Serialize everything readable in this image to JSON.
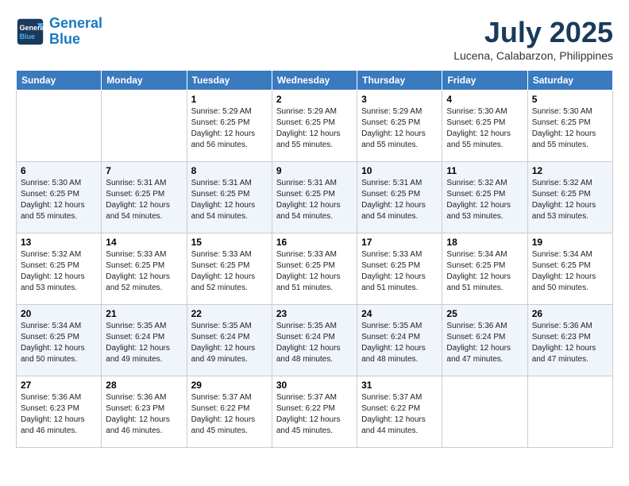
{
  "header": {
    "logo_line1": "General",
    "logo_line2": "Blue",
    "month": "July 2025",
    "location": "Lucena, Calabarzon, Philippines"
  },
  "days_of_week": [
    "Sunday",
    "Monday",
    "Tuesday",
    "Wednesday",
    "Thursday",
    "Friday",
    "Saturday"
  ],
  "weeks": [
    [
      {
        "day": "",
        "sunrise": "",
        "sunset": "",
        "daylight": ""
      },
      {
        "day": "",
        "sunrise": "",
        "sunset": "",
        "daylight": ""
      },
      {
        "day": "1",
        "sunrise": "Sunrise: 5:29 AM",
        "sunset": "Sunset: 6:25 PM",
        "daylight": "Daylight: 12 hours and 56 minutes."
      },
      {
        "day": "2",
        "sunrise": "Sunrise: 5:29 AM",
        "sunset": "Sunset: 6:25 PM",
        "daylight": "Daylight: 12 hours and 55 minutes."
      },
      {
        "day": "3",
        "sunrise": "Sunrise: 5:29 AM",
        "sunset": "Sunset: 6:25 PM",
        "daylight": "Daylight: 12 hours and 55 minutes."
      },
      {
        "day": "4",
        "sunrise": "Sunrise: 5:30 AM",
        "sunset": "Sunset: 6:25 PM",
        "daylight": "Daylight: 12 hours and 55 minutes."
      },
      {
        "day": "5",
        "sunrise": "Sunrise: 5:30 AM",
        "sunset": "Sunset: 6:25 PM",
        "daylight": "Daylight: 12 hours and 55 minutes."
      }
    ],
    [
      {
        "day": "6",
        "sunrise": "Sunrise: 5:30 AM",
        "sunset": "Sunset: 6:25 PM",
        "daylight": "Daylight: 12 hours and 55 minutes."
      },
      {
        "day": "7",
        "sunrise": "Sunrise: 5:31 AM",
        "sunset": "Sunset: 6:25 PM",
        "daylight": "Daylight: 12 hours and 54 minutes."
      },
      {
        "day": "8",
        "sunrise": "Sunrise: 5:31 AM",
        "sunset": "Sunset: 6:25 PM",
        "daylight": "Daylight: 12 hours and 54 minutes."
      },
      {
        "day": "9",
        "sunrise": "Sunrise: 5:31 AM",
        "sunset": "Sunset: 6:25 PM",
        "daylight": "Daylight: 12 hours and 54 minutes."
      },
      {
        "day": "10",
        "sunrise": "Sunrise: 5:31 AM",
        "sunset": "Sunset: 6:25 PM",
        "daylight": "Daylight: 12 hours and 54 minutes."
      },
      {
        "day": "11",
        "sunrise": "Sunrise: 5:32 AM",
        "sunset": "Sunset: 6:25 PM",
        "daylight": "Daylight: 12 hours and 53 minutes."
      },
      {
        "day": "12",
        "sunrise": "Sunrise: 5:32 AM",
        "sunset": "Sunset: 6:25 PM",
        "daylight": "Daylight: 12 hours and 53 minutes."
      }
    ],
    [
      {
        "day": "13",
        "sunrise": "Sunrise: 5:32 AM",
        "sunset": "Sunset: 6:25 PM",
        "daylight": "Daylight: 12 hours and 53 minutes."
      },
      {
        "day": "14",
        "sunrise": "Sunrise: 5:33 AM",
        "sunset": "Sunset: 6:25 PM",
        "daylight": "Daylight: 12 hours and 52 minutes."
      },
      {
        "day": "15",
        "sunrise": "Sunrise: 5:33 AM",
        "sunset": "Sunset: 6:25 PM",
        "daylight": "Daylight: 12 hours and 52 minutes."
      },
      {
        "day": "16",
        "sunrise": "Sunrise: 5:33 AM",
        "sunset": "Sunset: 6:25 PM",
        "daylight": "Daylight: 12 hours and 51 minutes."
      },
      {
        "day": "17",
        "sunrise": "Sunrise: 5:33 AM",
        "sunset": "Sunset: 6:25 PM",
        "daylight": "Daylight: 12 hours and 51 minutes."
      },
      {
        "day": "18",
        "sunrise": "Sunrise: 5:34 AM",
        "sunset": "Sunset: 6:25 PM",
        "daylight": "Daylight: 12 hours and 51 minutes."
      },
      {
        "day": "19",
        "sunrise": "Sunrise: 5:34 AM",
        "sunset": "Sunset: 6:25 PM",
        "daylight": "Daylight: 12 hours and 50 minutes."
      }
    ],
    [
      {
        "day": "20",
        "sunrise": "Sunrise: 5:34 AM",
        "sunset": "Sunset: 6:25 PM",
        "daylight": "Daylight: 12 hours and 50 minutes."
      },
      {
        "day": "21",
        "sunrise": "Sunrise: 5:35 AM",
        "sunset": "Sunset: 6:24 PM",
        "daylight": "Daylight: 12 hours and 49 minutes."
      },
      {
        "day": "22",
        "sunrise": "Sunrise: 5:35 AM",
        "sunset": "Sunset: 6:24 PM",
        "daylight": "Daylight: 12 hours and 49 minutes."
      },
      {
        "day": "23",
        "sunrise": "Sunrise: 5:35 AM",
        "sunset": "Sunset: 6:24 PM",
        "daylight": "Daylight: 12 hours and 48 minutes."
      },
      {
        "day": "24",
        "sunrise": "Sunrise: 5:35 AM",
        "sunset": "Sunset: 6:24 PM",
        "daylight": "Daylight: 12 hours and 48 minutes."
      },
      {
        "day": "25",
        "sunrise": "Sunrise: 5:36 AM",
        "sunset": "Sunset: 6:24 PM",
        "daylight": "Daylight: 12 hours and 47 minutes."
      },
      {
        "day": "26",
        "sunrise": "Sunrise: 5:36 AM",
        "sunset": "Sunset: 6:23 PM",
        "daylight": "Daylight: 12 hours and 47 minutes."
      }
    ],
    [
      {
        "day": "27",
        "sunrise": "Sunrise: 5:36 AM",
        "sunset": "Sunset: 6:23 PM",
        "daylight": "Daylight: 12 hours and 46 minutes."
      },
      {
        "day": "28",
        "sunrise": "Sunrise: 5:36 AM",
        "sunset": "Sunset: 6:23 PM",
        "daylight": "Daylight: 12 hours and 46 minutes."
      },
      {
        "day": "29",
        "sunrise": "Sunrise: 5:37 AM",
        "sunset": "Sunset: 6:22 PM",
        "daylight": "Daylight: 12 hours and 45 minutes."
      },
      {
        "day": "30",
        "sunrise": "Sunrise: 5:37 AM",
        "sunset": "Sunset: 6:22 PM",
        "daylight": "Daylight: 12 hours and 45 minutes."
      },
      {
        "day": "31",
        "sunrise": "Sunrise: 5:37 AM",
        "sunset": "Sunset: 6:22 PM",
        "daylight": "Daylight: 12 hours and 44 minutes."
      },
      {
        "day": "",
        "sunrise": "",
        "sunset": "",
        "daylight": ""
      },
      {
        "day": "",
        "sunrise": "",
        "sunset": "",
        "daylight": ""
      }
    ]
  ]
}
